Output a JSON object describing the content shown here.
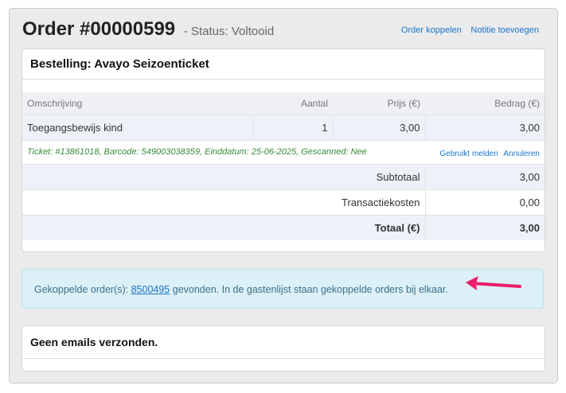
{
  "header": {
    "title": "Order #00000599",
    "status": "- Status: Voltooid",
    "links": {
      "koppelen": "Order koppelen",
      "notitie": "Notitie toevoegen"
    }
  },
  "bestelling": {
    "heading": "Bestelling: Avayo Seizoenticket",
    "columns": {
      "omschrijving": "Omschrijving",
      "aantal": "Aantal",
      "prijs": "Prijs (€)",
      "bedrag": "Bedrag (€)"
    },
    "item": {
      "omschrijving": "Toegangsbewijs kind",
      "aantal": "1",
      "prijs": "3,00",
      "bedrag": "3,00"
    },
    "ticket": {
      "info": "Ticket: #13861018, Barcode: 549003038359, Einddatum: 25-06-2025, Gescanned: Nee",
      "gebruikt_melden": "Gebruikt melden",
      "annuleren": "Annuleren"
    },
    "subtotaal": {
      "label": "Subtotaal",
      "value": "3,00"
    },
    "transactiekosten": {
      "label": "Transactiekosten",
      "value": "0,00"
    },
    "totaal": {
      "label": "Totaal (€)",
      "value": "3,00"
    }
  },
  "info": {
    "prefix": "Gekoppelde order(s): ",
    "order_link": "8500495",
    "suffix": " gevonden. In de gastenlijst staan gekoppelde orders bij elkaar."
  },
  "emails": {
    "heading": "Geen emails verzonden."
  },
  "colors": {
    "link": "#1a73c9",
    "info_bg": "#dcf0f7",
    "arrow": "#ee1d6a",
    "ticket_text": "#3a8a3a"
  },
  "icons": {
    "annotation": "arrow-left-icon"
  }
}
